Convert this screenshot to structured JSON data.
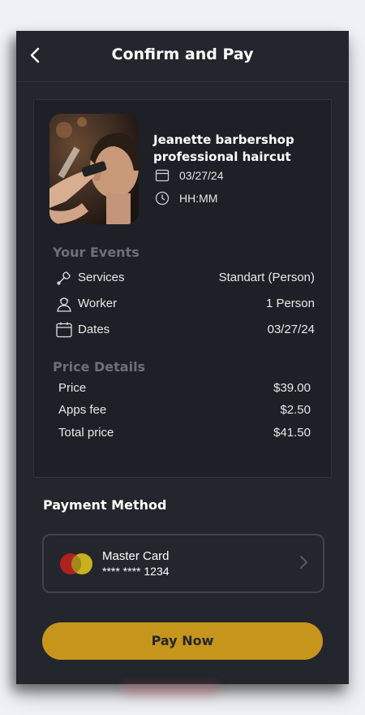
{
  "header": {
    "title": "Confirm and Pay",
    "back_icon": "chevron-left-icon"
  },
  "booking": {
    "shop_name": "Jeanette barbershop professional haircut",
    "date": "03/27/24",
    "time": "HH:MM"
  },
  "events": {
    "heading": "Your Events",
    "rows": [
      {
        "icon": "wrench-icon",
        "label": "Services",
        "value": "Standart (Person)"
      },
      {
        "icon": "worker-icon",
        "label": "Worker",
        "value": "1 Person"
      },
      {
        "icon": "calendar-icon",
        "label": "Dates",
        "value": "03/27/24"
      }
    ]
  },
  "price": {
    "heading": "Price Details",
    "rows": [
      {
        "label": "Price",
        "value": "$39.00"
      },
      {
        "label": "Apps fee",
        "value": "$2.50"
      },
      {
        "label": "Total price",
        "value": "$41.50"
      }
    ]
  },
  "payment": {
    "heading": "Payment Method",
    "card_name": "Master Card",
    "card_number": "**** **** 1234"
  },
  "pay_button": "Pay Now",
  "colors": {
    "accent": "#c6951c",
    "background": "#23262d",
    "card": "#1d2027"
  }
}
